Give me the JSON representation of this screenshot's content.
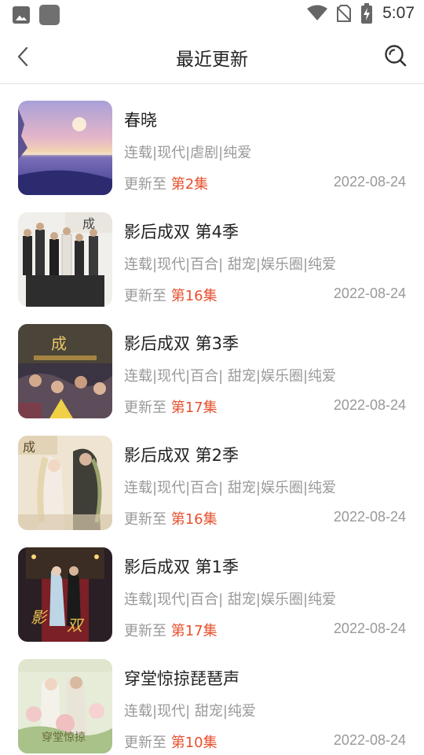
{
  "status_bar": {
    "time": "5:07",
    "icons": [
      "image-icon",
      "app-icon",
      "wifi-icon",
      "no-sim-icon",
      "battery-charging-icon"
    ]
  },
  "header": {
    "title": "最近更新",
    "back_icon": "chevron-left-icon",
    "search_icon": "search-icon"
  },
  "items": [
    {
      "title": "春晓",
      "tags": "连载|现代|虐剧|纯爱",
      "update_prefix": "更新至 ",
      "episode": "第2集",
      "date": "2022-08-24"
    },
    {
      "title": "影后成双 第4季",
      "tags": "连载|现代|百合| 甜宠|娱乐圈|纯爱",
      "update_prefix": "更新至 ",
      "episode": "第16集",
      "date": "2022-08-24"
    },
    {
      "title": "影后成双 第3季",
      "tags": "连载|现代|百合| 甜宠|娱乐圈|纯爱",
      "update_prefix": "更新至 ",
      "episode": "第17集",
      "date": "2022-08-24"
    },
    {
      "title": "影后成双 第2季",
      "tags": "连载|现代|百合| 甜宠|娱乐圈|纯爱",
      "update_prefix": "更新至 ",
      "episode": "第16集",
      "date": "2022-08-24"
    },
    {
      "title": "影后成双 第1季",
      "tags": "连载|现代|百合| 甜宠|娱乐圈|纯爱",
      "update_prefix": "更新至 ",
      "episode": "第17集",
      "date": "2022-08-24"
    },
    {
      "title": "穿堂惊掠琵琶声",
      "tags": "连载|现代| 甜宠|纯爱",
      "update_prefix": "更新至 ",
      "episode": "第10集",
      "date": "2022-08-24"
    }
  ],
  "colors": {
    "accent": "#e8502e",
    "secondary_text": "#999999",
    "primary_text": "#222222"
  }
}
